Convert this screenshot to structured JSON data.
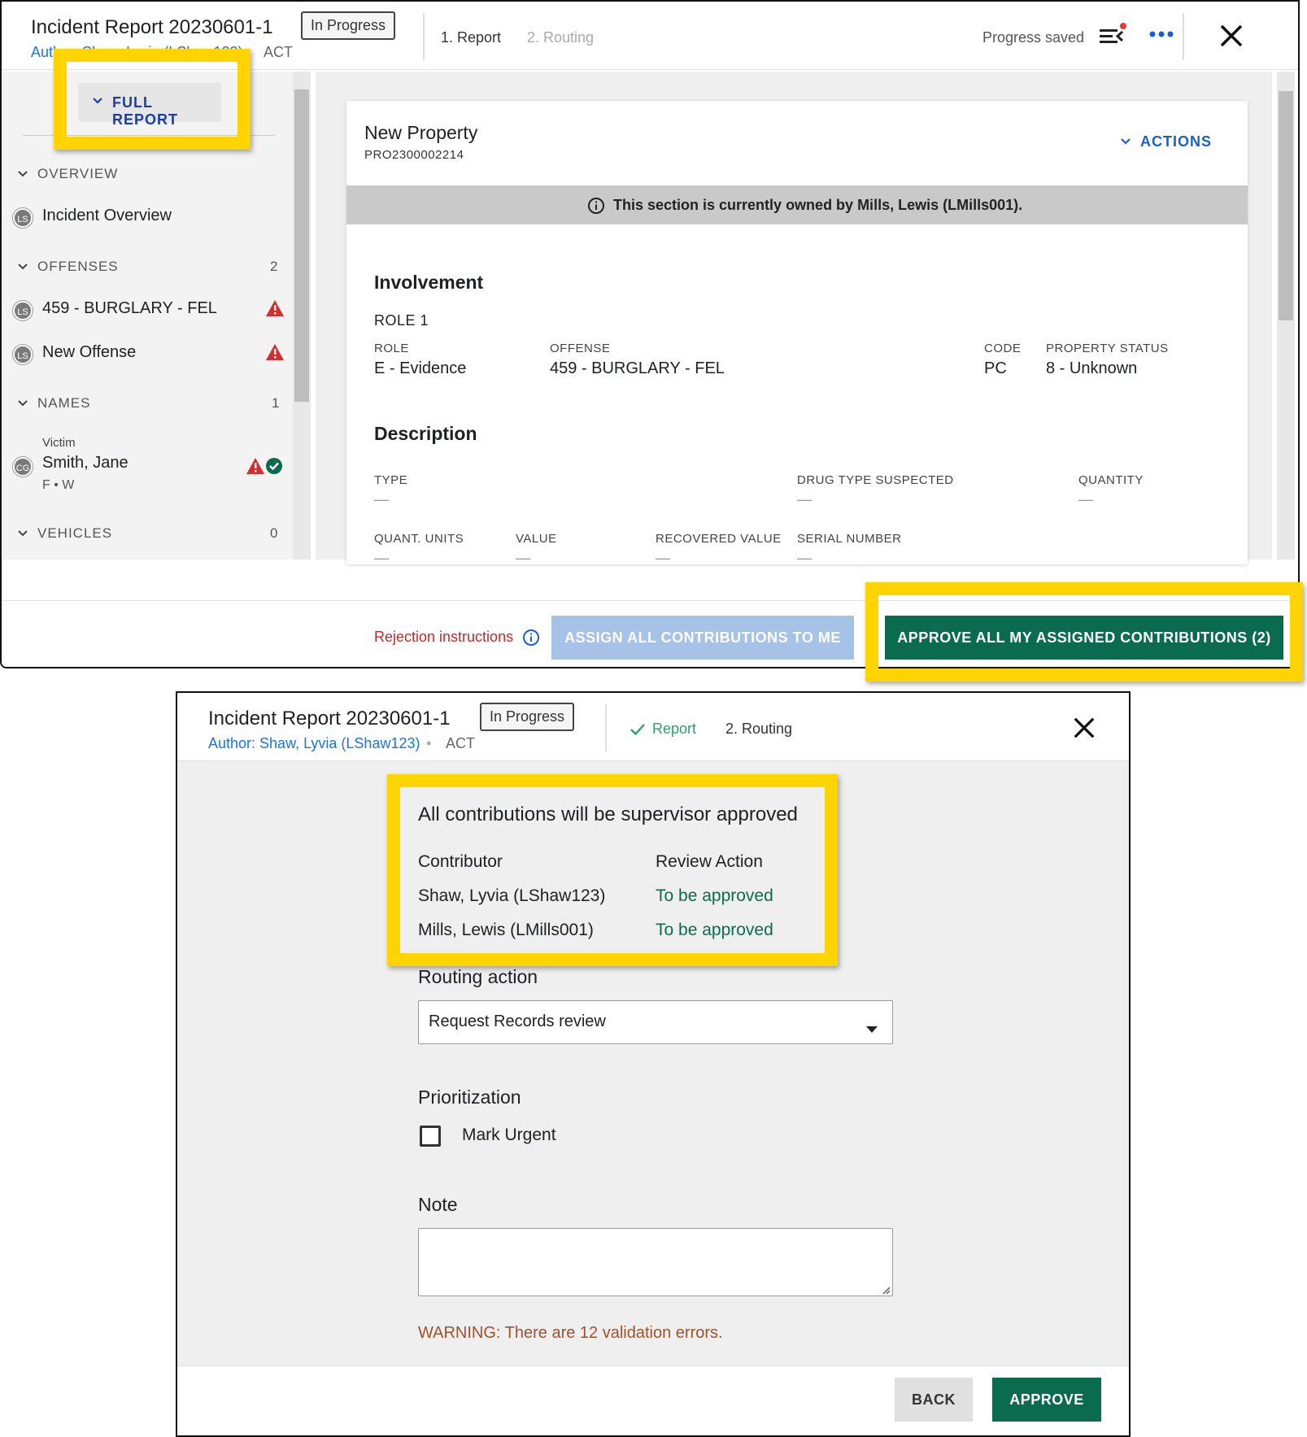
{
  "top": {
    "header": {
      "title": "Incident Report 20230601-1",
      "status_badge": "In Progress",
      "author": "Author: Shaw, Lyvia (LShaw123)",
      "agency": "ACT",
      "step1": "1. Report",
      "step2": "2. Routing",
      "progress_saved": "Progress saved",
      "icons": [
        "list-alert-icon",
        "more-icon",
        "close-icon"
      ]
    },
    "left": {
      "full_report": "FULL REPORT",
      "sections": [
        {
          "label": "OVERVIEW",
          "count": ""
        },
        {
          "label": "OFFENSES",
          "count": "2"
        },
        {
          "label": "NAMES",
          "count": "1"
        },
        {
          "label": "VEHICLES",
          "count": "0"
        }
      ],
      "items": {
        "overview": {
          "avatar": "LS",
          "label": "Incident Overview"
        },
        "offense1": {
          "avatar": "LS",
          "label": "459 - BURGLARY - FEL"
        },
        "offense2": {
          "avatar": "LS",
          "label": "New Offense"
        },
        "name1": {
          "avatar": "CG",
          "role": "Victim",
          "label": "Smith, Jane",
          "sub": "F • W"
        }
      }
    },
    "card": {
      "title": "New Property",
      "id": "PRO2300002214",
      "actions": "ACTIONS",
      "owner_notice": "This section is currently owned by Mills, Lewis (LMills001).",
      "involvement": {
        "heading": "Involvement",
        "role_group": "ROLE 1",
        "fields": [
          {
            "label": "ROLE",
            "value": "E - Evidence"
          },
          {
            "label": "OFFENSE",
            "value": "459 - BURGLARY - FEL"
          },
          {
            "label": "CODE",
            "value": "PC"
          },
          {
            "label": "PROPERTY STATUS",
            "value": "8 - Unknown"
          }
        ]
      },
      "description": {
        "heading": "Description",
        "row1": [
          {
            "label": "TYPE",
            "value": "—"
          },
          {
            "label": "DRUG TYPE SUSPECTED",
            "value": "—"
          },
          {
            "label": "QUANTITY",
            "value": "—"
          }
        ],
        "row2": [
          {
            "label": "QUANT. UNITS",
            "value": "—"
          },
          {
            "label": "VALUE",
            "value": "—"
          },
          {
            "label": "RECOVERED VALUE",
            "value": "—"
          },
          {
            "label": "SERIAL NUMBER",
            "value": "—"
          }
        ]
      }
    },
    "footer": {
      "rejection": "Rejection instructions",
      "assign_all": "ASSIGN ALL CONTRIBUTIONS TO ME",
      "approve_all": "APPROVE ALL MY ASSIGNED CONTRIBUTIONS (2)"
    }
  },
  "bottom": {
    "header": {
      "title": "Incident Report 20230601-1",
      "status_badge": "In Progress",
      "author": "Author: Shaw, Lyvia (LShaw123)",
      "agency": "ACT",
      "step1": "Report",
      "step2": "2. Routing"
    },
    "approval": {
      "title": "All contributions will be supervisor approved",
      "col_contributor": "Contributor",
      "col_action": "Review Action",
      "rows": [
        {
          "contributor": "Shaw, Lyvia (LShaw123)",
          "action": "To be approved"
        },
        {
          "contributor": "Mills, Lewis (LMills001)",
          "action": "To be approved"
        }
      ]
    },
    "routing_label": "Routing action",
    "routing_value": "Request Records review",
    "prioritization_label": "Prioritization",
    "mark_urgent": "Mark Urgent",
    "mark_urgent_checked": false,
    "note_label": "Note",
    "note_value": "",
    "warning": "WARNING: There are 12 validation errors.",
    "back": "BACK",
    "approve": "APPROVE"
  },
  "colors": {
    "highlight": "#ffd400",
    "approve_green": "#0b6b4e",
    "link_blue": "#1a73e8",
    "warning_red": "#d32f2f"
  }
}
